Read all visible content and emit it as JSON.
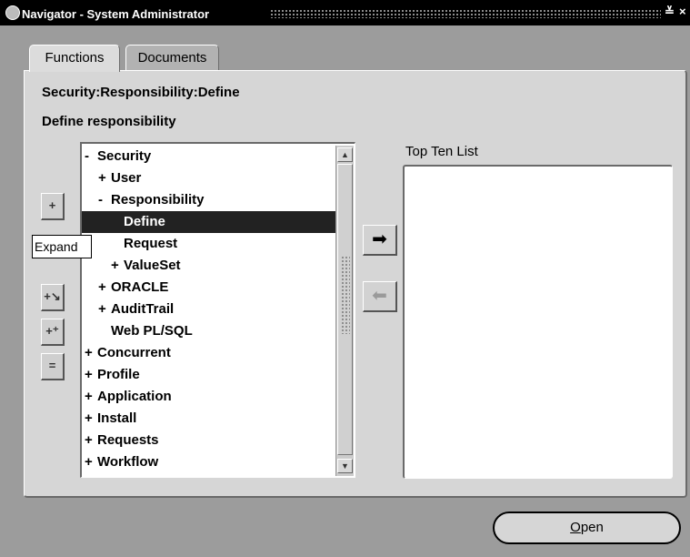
{
  "window": {
    "title": "Navigator - System Administrator",
    "minimize_glyph": "≚",
    "close_glyph": "×"
  },
  "tabs": [
    {
      "label": "Functions",
      "active": true
    },
    {
      "label": "Documents",
      "active": false
    }
  ],
  "main": {
    "path": "Security:Responsibility:Define",
    "heading": "Define responsibility"
  },
  "tool_buttons": [
    {
      "name": "expand-button",
      "glyph": "+",
      "icon": "expand-icon"
    },
    {
      "name": "expand-branch-button",
      "glyph": "+↘",
      "icon": "expand-branch-icon"
    },
    {
      "name": "expand-all-button",
      "glyph": "+⁺",
      "icon": "expand-all-icon"
    },
    {
      "name": "collapse-all-button",
      "glyph": "=",
      "icon": "collapse-all-icon"
    }
  ],
  "tooltip": "Expand",
  "tree": [
    {
      "glyph": "-",
      "label": "Security",
      "indent": 0
    },
    {
      "glyph": "+",
      "label": "User",
      "indent": 1
    },
    {
      "glyph": "-",
      "label": "Responsibility",
      "indent": 1
    },
    {
      "glyph": "",
      "label": "Define",
      "indent": 2,
      "selected": true
    },
    {
      "glyph": "",
      "label": "Request",
      "indent": 2
    },
    {
      "glyph": "+",
      "label": "ValueSet",
      "indent": 2
    },
    {
      "glyph": "+",
      "label": "ORACLE",
      "indent": 1
    },
    {
      "glyph": "+",
      "label": "AuditTrail",
      "indent": 1
    },
    {
      "glyph": "",
      "label": "Web PL/SQL",
      "indent": 1
    },
    {
      "glyph": "+",
      "label": "Concurrent",
      "indent": 0
    },
    {
      "glyph": "+",
      "label": "Profile",
      "indent": 0
    },
    {
      "glyph": "+",
      "label": "Application",
      "indent": 0
    },
    {
      "glyph": "+",
      "label": "Install",
      "indent": 0
    },
    {
      "glyph": "+",
      "label": "Requests",
      "indent": 0
    },
    {
      "glyph": "+",
      "label": "Workflow",
      "indent": 0
    }
  ],
  "move_buttons": {
    "add_glyph": "➡",
    "remove_glyph": "⬅"
  },
  "top_ten": {
    "label": "Top Ten List",
    "items": []
  },
  "open_button": {
    "mnemonic": "O",
    "rest": "pen"
  }
}
